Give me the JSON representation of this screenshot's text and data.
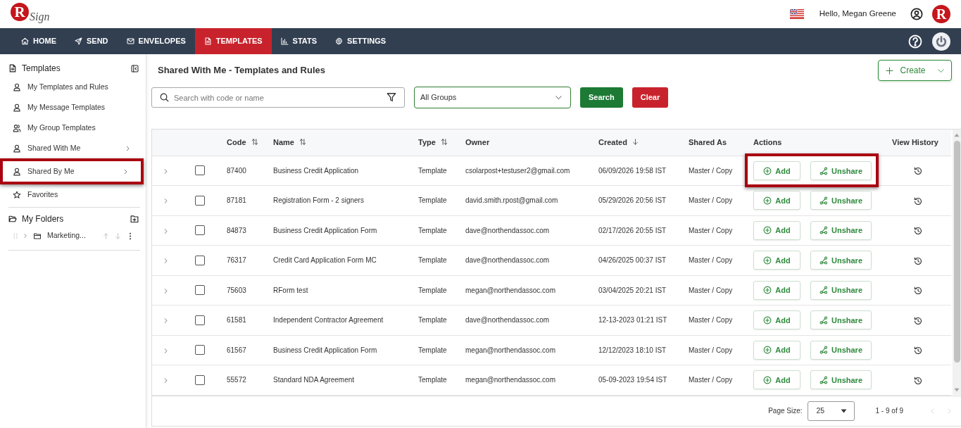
{
  "header": {
    "logo": {
      "initial": "R",
      "wordmark": "Sign"
    },
    "greeting": "Hello, Megan Greene",
    "brand_badge": "R"
  },
  "nav": {
    "items": [
      {
        "label": "HOME",
        "selected": false
      },
      {
        "label": "SEND",
        "selected": false
      },
      {
        "label": "ENVELOPES",
        "selected": false
      },
      {
        "label": "TEMPLATES",
        "selected": true
      },
      {
        "label": "STATS",
        "selected": false
      },
      {
        "label": "SETTINGS",
        "selected": false
      }
    ]
  },
  "sidebar": {
    "title": "Templates",
    "items": [
      {
        "label": "My Templates and Rules",
        "submenu": false,
        "highlighted": false
      },
      {
        "label": "My Message Templates",
        "submenu": false,
        "highlighted": false
      },
      {
        "label": "My Group Templates",
        "submenu": false,
        "highlighted": false
      },
      {
        "label": "Shared With Me",
        "submenu": true,
        "highlighted": false
      },
      {
        "label": "Shared By Me",
        "submenu": true,
        "highlighted": true
      },
      {
        "label": "Favorites",
        "submenu": false,
        "highlighted": false
      }
    ],
    "folders_title": "My Folders",
    "folders": [
      {
        "label": "Marketing...",
        "expanded": false
      }
    ]
  },
  "main": {
    "title": "Shared With Me - Templates and Rules",
    "create_button": "Create",
    "search": {
      "placeholder": "Search with code or name"
    },
    "group_filter": {
      "value": "All Groups"
    },
    "buttons": [
      {
        "label": "Search",
        "kind": "primary"
      },
      {
        "label": "Clear",
        "kind": "danger"
      }
    ]
  },
  "table": {
    "columns": [
      {
        "label": "Code",
        "sortable": true,
        "sorted": false
      },
      {
        "label": "Name",
        "sortable": true,
        "sorted": false
      },
      {
        "label": "Type",
        "sortable": true,
        "sorted": false
      },
      {
        "label": "Owner",
        "sortable": false,
        "sorted": false
      },
      {
        "label": "Created",
        "sortable": true,
        "sorted": true
      },
      {
        "label": "Shared As",
        "sortable": false,
        "sorted": false
      },
      {
        "label": "Actions",
        "sortable": false,
        "sorted": false
      },
      {
        "label": "View History",
        "sortable": false,
        "sorted": false
      }
    ],
    "rows": [
      {
        "cells": [
          "87400",
          "Business Credit Application",
          "Template",
          "csolarpost+testuser2@gmail.com",
          "06/09/2026 19:58 IST",
          "Master / Copy"
        ],
        "actions": [
          "Add",
          "Unshare"
        ],
        "checked": false,
        "expanded": false,
        "highlighted": true
      },
      {
        "cells": [
          "87181",
          "Registration Form - 2 signers",
          "Template",
          "david.smith.rpost@gmail.com",
          "05/29/2026 20:56 IST",
          "Master / Copy"
        ],
        "actions": [
          "Add",
          "Unshare"
        ],
        "checked": false,
        "expanded": false,
        "highlighted": false
      },
      {
        "cells": [
          "84873",
          "Business Credit Application Form",
          "Template",
          "dave@northendassoc.com",
          "02/17/2026 20:55 IST",
          "Master / Copy"
        ],
        "actions": [
          "Add",
          "Unshare"
        ],
        "checked": false,
        "expanded": false,
        "highlighted": false
      },
      {
        "cells": [
          "76317",
          "Credit Card Application Form MC",
          "Template",
          "dave@northendassoc.com",
          "04/26/2025 00:37 IST",
          "Master / Copy"
        ],
        "actions": [
          "Add",
          "Unshare"
        ],
        "checked": false,
        "expanded": false,
        "highlighted": false
      },
      {
        "cells": [
          "75603",
          "RForm test",
          "Template",
          "megan@northendassoc.com",
          "03/04/2025 20:21 IST",
          "Master / Copy"
        ],
        "actions": [
          "Add",
          "Unshare"
        ],
        "checked": false,
        "expanded": false,
        "highlighted": false
      },
      {
        "cells": [
          "61581",
          "Independent Contractor Agreement",
          "Template",
          "dave@northendassoc.com",
          "12-13-2023 01:21 IST",
          "Master / Copy"
        ],
        "actions": [
          "Add",
          "Unshare"
        ],
        "checked": false,
        "expanded": false,
        "highlighted": false
      },
      {
        "cells": [
          "61567",
          "Business Credit Application Form",
          "Template",
          "megan@northendassoc.com",
          "12/12/2023 18:10 IST",
          "Master / Copy"
        ],
        "actions": [
          "Add",
          "Unshare"
        ],
        "checked": false,
        "expanded": false,
        "highlighted": false
      },
      {
        "cells": [
          "55572",
          "Standard NDA Agreement",
          "Template",
          "megan@northendassoc.com",
          "05-09-2023 19:54 IST",
          "Master / Copy"
        ],
        "actions": [
          "Add",
          "Unshare"
        ],
        "checked": false,
        "expanded": false,
        "highlighted": false
      }
    ]
  },
  "pagination": {
    "page_size_label": "Page Size:",
    "page_size": "25",
    "range": "1 - 9 of 9",
    "prev_disabled": true,
    "next_disabled": true
  }
}
